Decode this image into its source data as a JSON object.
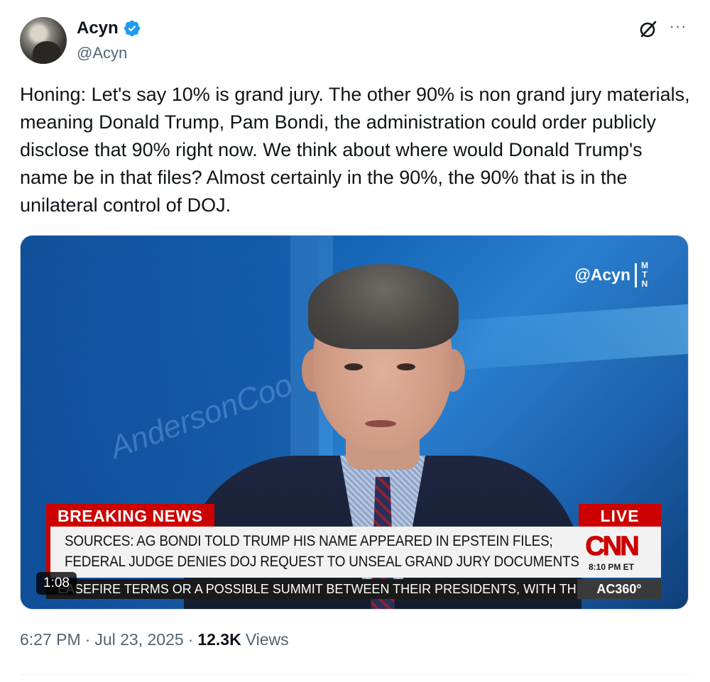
{
  "author": {
    "name": "Acyn",
    "handle": "@Acyn",
    "verified": true,
    "verified_color": "#1d9bf0"
  },
  "header_actions": {
    "grok_icon": "grok-slash-icon",
    "more_label": "···"
  },
  "tweet": {
    "text": "Honing: Let's say 10% is grand jury. The other 90% is non grand jury materials, meaning Donald Trump, Pam Bondi, the administration could order publicly disclose that 90% right now. We think about where would Donald Trump's name be in that files? Almost certainly in the 90%, the 90% that is in the unilateral control of DOJ."
  },
  "video": {
    "duration": "1:08",
    "watermark_handle": "@Acyn",
    "watermark_mtn": [
      "M",
      "T",
      "N"
    ],
    "background_text": "AndersonCoo",
    "breaking_label": "BREAKING NEWS",
    "live_label": "LIVE",
    "headline_lines": [
      "SOURCES: AG BONDI TOLD TRUMP HIS NAME APPEARED IN EPSTEIN FILES;",
      "FEDERAL JUDGE DENIES DOJ REQUEST TO UNSEAL GRAND JURY DOCUMENTS"
    ],
    "network": "CNN",
    "time": "8:10 PM ET",
    "ticker": "EASEFIRE TERMS OR A POSSIBLE SUMMIT BETWEEN THEIR PRESIDENTS, WITH THEIR I",
    "show_tag": "AC360°",
    "brand_red": "#cc0000"
  },
  "meta": {
    "time": "6:27 PM",
    "date": "Jul 23, 2025",
    "separator": "·",
    "views_count": "12.3K",
    "views_label": "Views"
  }
}
